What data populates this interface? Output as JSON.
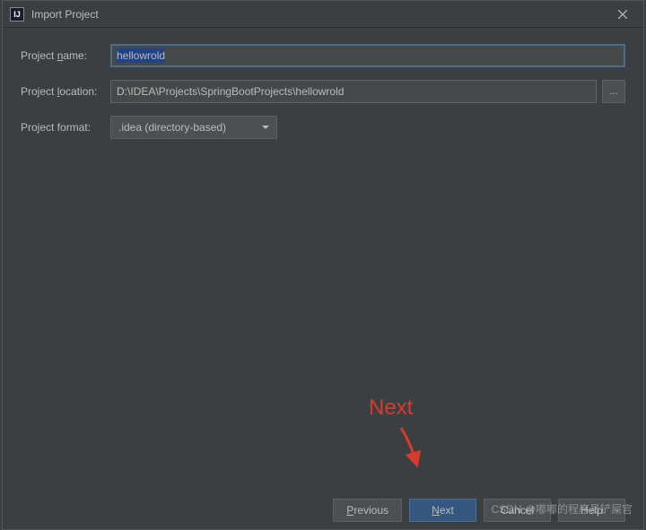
{
  "window": {
    "title": "Import Project",
    "icon_label": "IJ"
  },
  "form": {
    "project_name": {
      "label": "Project name:",
      "mnemonic": "n",
      "value": "hellowrold"
    },
    "project_location": {
      "label": "Project location:",
      "mnemonic": "l",
      "value": "D:\\IDEA\\Projects\\SpringBootProjects\\hellowrold",
      "browse_label": "..."
    },
    "project_format": {
      "label": "Project format:",
      "selected": ".idea (directory-based)"
    }
  },
  "buttons": {
    "previous": "Previous",
    "previous_mnemonic": "P",
    "next": "Next",
    "next_mnemonic": "N",
    "cancel": "Cancel",
    "help": "Help"
  },
  "annotation": {
    "text": "Next"
  },
  "watermark": "CSDN @嘟嘟的程序员铲屎官"
}
